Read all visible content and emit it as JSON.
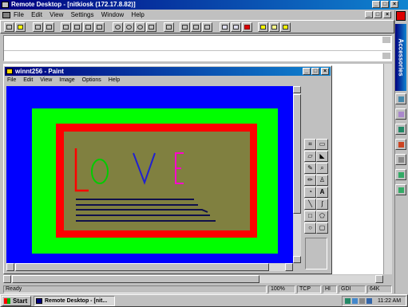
{
  "remote_window": {
    "title": "Remote Desktop - [nitkiosk (172.17.8.82)]",
    "menu": [
      "File",
      "Edit",
      "View",
      "Settings",
      "Window",
      "Help"
    ],
    "status": {
      "left": "Ready",
      "zoom": "100%",
      "protocol": "TCP",
      "quality": "HI",
      "api": "GDI",
      "size": "64K"
    }
  },
  "side_panel": {
    "label": "Accessories"
  },
  "paint_window": {
    "title": "winnt256 - Paint",
    "menu": [
      "File",
      "Edit",
      "View",
      "Image",
      "Options",
      "Help"
    ]
  },
  "canvas": {
    "letters": [
      "L",
      "O",
      "V",
      "E"
    ],
    "letter_colors": [
      "#ff0000",
      "#00cc00",
      "#2020d0",
      "#ff00cc"
    ],
    "outer_color": "#0000ff",
    "green_color": "#00ff00",
    "red_color": "#ff0000",
    "inner_color": "#808040"
  },
  "taskbar": {
    "start_label": "Start",
    "task_label": "Remote Desktop - [nit...",
    "clock": "11:22 AM"
  }
}
